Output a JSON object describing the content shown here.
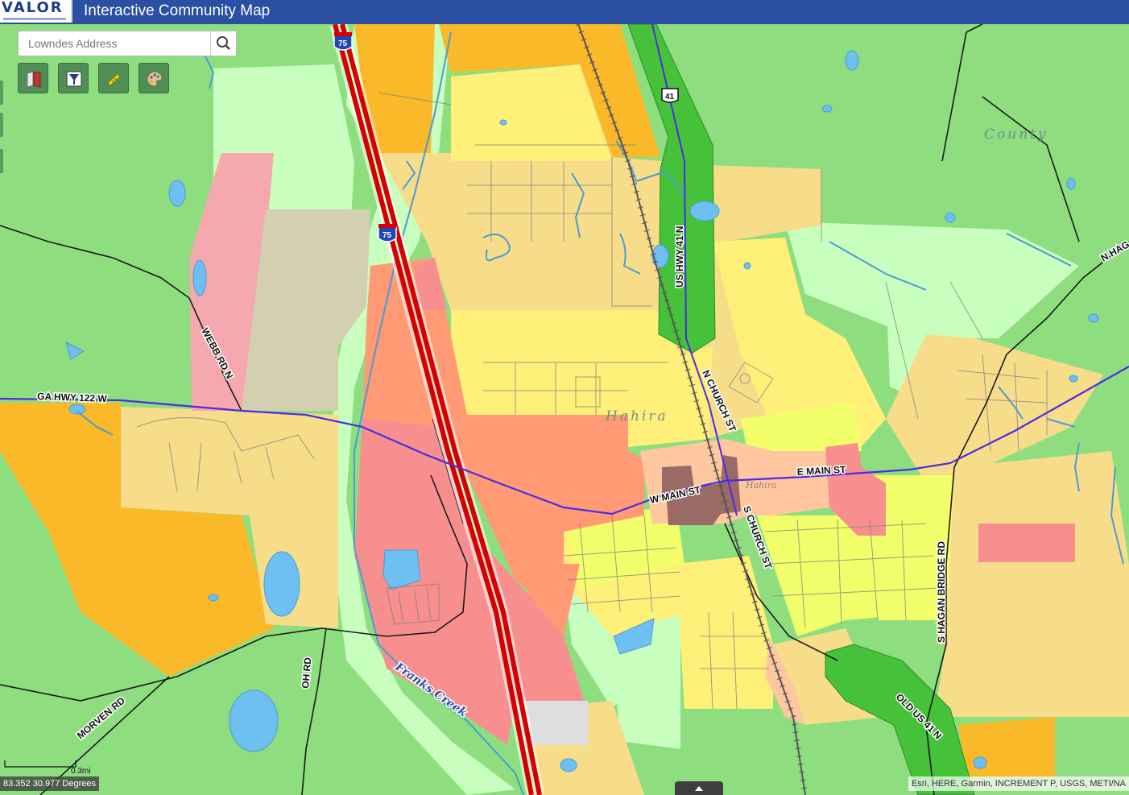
{
  "app": {
    "logo_text": "VALOR",
    "title": "Interactive Community Map"
  },
  "search": {
    "placeholder": "Lowndes Address",
    "icon": "search-icon"
  },
  "tools": [
    {
      "name": "legend-book-icon"
    },
    {
      "name": "filter-icon"
    },
    {
      "name": "measure-ruler-icon"
    },
    {
      "name": "basemap-palette-icon"
    }
  ],
  "map": {
    "place_labels": {
      "county": "County",
      "city": "Hahira",
      "city_small": "Hahira"
    },
    "water_label": "Franks Creek",
    "road_labels": {
      "ga122": "GA HWY 122 W",
      "webb": "WEBB RD N",
      "us41": "US HWY 41 N",
      "n_church": "N CHURCH ST",
      "s_church": "S CHURCH ST",
      "w_main": "W MAIN ST",
      "e_main": "E MAIN ST",
      "s_hagan": "S HAGAN BRIDGE RD",
      "n_hagan": "N HAG",
      "old41": "OLD US 41 N",
      "morven": "MORVEN RD",
      "oh": "OH RD"
    },
    "shields": {
      "i75": "75",
      "us41": "41"
    },
    "colors": {
      "agriculture": "#8ede80",
      "low_density_res": "#f7dd8a",
      "suburban": "#fff07a",
      "rural_res": "#f9b928",
      "park": "#c8ffbf",
      "commercial": "#f78f8f",
      "highway_commercial": "#ff9a75",
      "industrial": "#f5a8ad",
      "downtown": "#9a6a66",
      "water": "#6fc0f2",
      "interstate": "#e00000",
      "state_route": "#4b2ce0",
      "transport_corridor": "#45c23a"
    }
  },
  "scale": {
    "label": "0.3mi"
  },
  "coordinates": "83.352 30.977 Degrees",
  "attribution": "Esri, HERE, Garmin, INCREMENT P, USGS, METI/NA"
}
